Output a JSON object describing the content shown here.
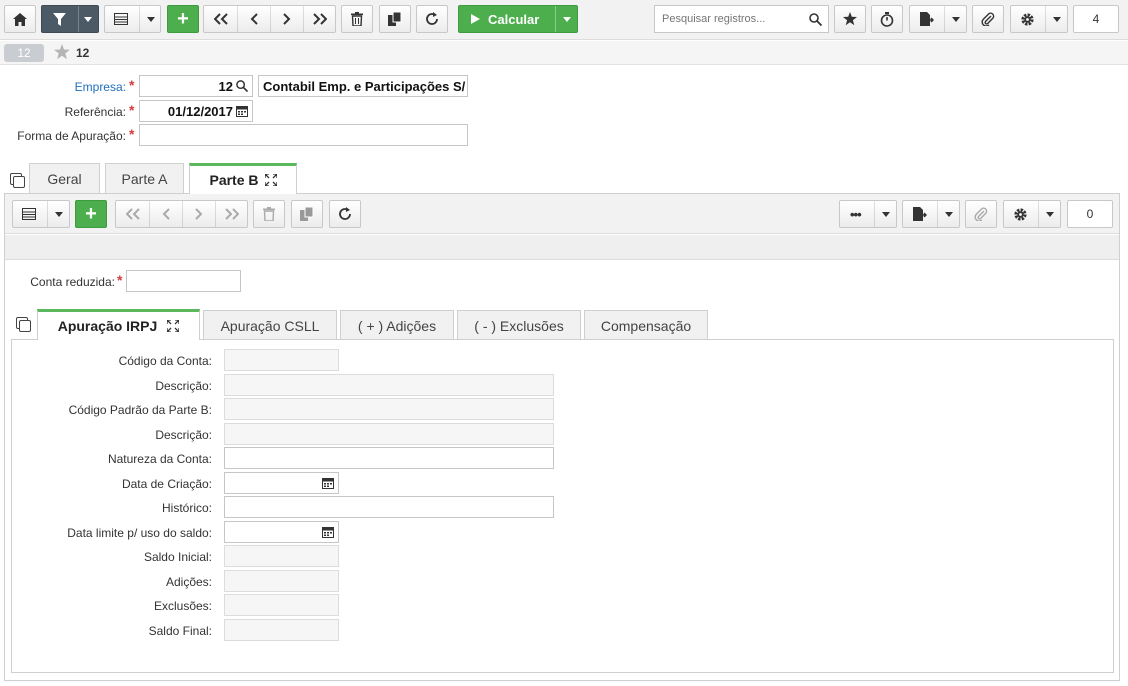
{
  "toolbar": {
    "calculate_label": "Calcular",
    "search_placeholder": "Pesquisar registros...",
    "record_count": "4"
  },
  "record": {
    "badge": "12",
    "title": "12"
  },
  "form": {
    "empresa_label": "Empresa:",
    "empresa_code": "12",
    "empresa_name": "Contabil Emp. e Participações S/",
    "referencia_label": "Referência:",
    "referencia_value": "01/12/2017",
    "forma_label": "Forma de Apuração:",
    "forma_value": ""
  },
  "tabs": {
    "geral": "Geral",
    "parte_a": "Parte A",
    "parte_b": "Parte B"
  },
  "sub_toolbar": {
    "record_count": "0"
  },
  "conta": {
    "label": "Conta reduzida:",
    "value": ""
  },
  "inner_tabs": {
    "irpj": "Apuração IRPJ",
    "csll": "Apuração CSLL",
    "adicoes": "( + ) Adições",
    "exclusoes": "( - ) Exclusões",
    "compensacao": "Compensação"
  },
  "details": {
    "codigo_conta": "Código da Conta:",
    "descricao1": "Descrição:",
    "codigo_padrao": "Código Padrão da Parte B:",
    "descricao2": "Descrição:",
    "natureza": "Natureza da Conta:",
    "data_criacao": "Data de Criação:",
    "historico": "Histórico:",
    "data_limite": "Data limite p/ uso do saldo:",
    "saldo_inicial": "Saldo Inicial:",
    "adicoes": "Adições:",
    "exclusoes": "Exclusões:",
    "saldo_final": "Saldo Final:"
  },
  "colors": {
    "accent_green": "#4cae4c",
    "dark_button": "#4c5a66",
    "link_blue": "#1f6fbf",
    "required_red": "#d23c3c"
  }
}
